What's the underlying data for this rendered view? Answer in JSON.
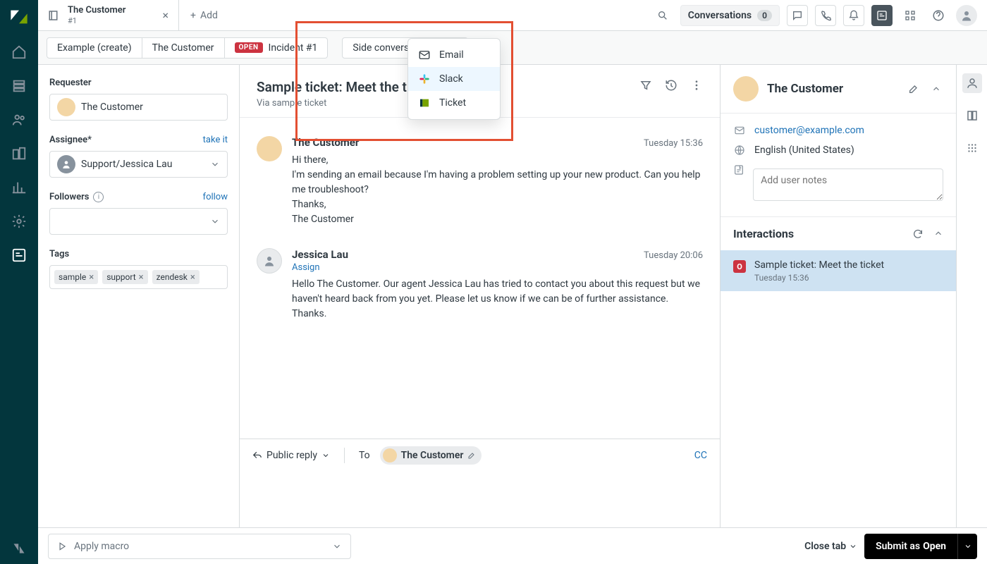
{
  "topbar": {
    "tab": {
      "title": "The Customer",
      "sub": "#1"
    },
    "add_label": "Add",
    "conversations_label": "Conversations",
    "conversations_count": "0"
  },
  "subtabs": {
    "t0": "Example (create)",
    "t1": "The Customer",
    "incident_badge": "OPEN",
    "incident_label": "Incident #1",
    "side_conv": "Side conversations"
  },
  "dropdown": {
    "email": "Email",
    "slack": "Slack",
    "ticket": "Ticket"
  },
  "left": {
    "requester_label": "Requester",
    "requester_value": "The Customer",
    "assignee_label": "Assignee*",
    "take_it": "take it",
    "assignee_value": "Support/Jessica Lau",
    "followers_label": "Followers",
    "follow": "follow",
    "tags_label": "Tags",
    "tag0": "sample",
    "tag1": "support",
    "tag2": "zendesk"
  },
  "conv": {
    "title": "Sample ticket: Meet the ticket",
    "via": "Via sample ticket",
    "m0_author": "The Customer",
    "m0_ts": "Tuesday 15:36",
    "m0_body": "Hi there,\nI'm sending an email because I'm having a problem setting up your new product. Can you help me troubleshoot?\nThanks,\nThe Customer",
    "m1_author": "Jessica Lau",
    "m1_ts": "Tuesday 20:06",
    "m1_assign": "Assign",
    "m1_body": "Hello The Customer. Our agent Jessica Lau has tried to contact you about this request but we haven't heard back from you yet. Please let us know if we can be of further assistance. Thanks."
  },
  "reply": {
    "type": "Public reply",
    "to_label": "To",
    "to_chip": "The Customer",
    "cc": "CC"
  },
  "footer": {
    "macro": "Apply macro",
    "close_tab": "Close tab",
    "submit_prefix": "Submit as ",
    "submit_status": "Open"
  },
  "right": {
    "name": "The Customer",
    "email": "customer@example.com",
    "language": "English (United States)",
    "notes_placeholder": "Add user notes",
    "interactions": "Interactions",
    "inter0_title": "Sample ticket: Meet the ticket",
    "inter0_ts": "Tuesday 15:36",
    "inter0_badge": "O"
  }
}
